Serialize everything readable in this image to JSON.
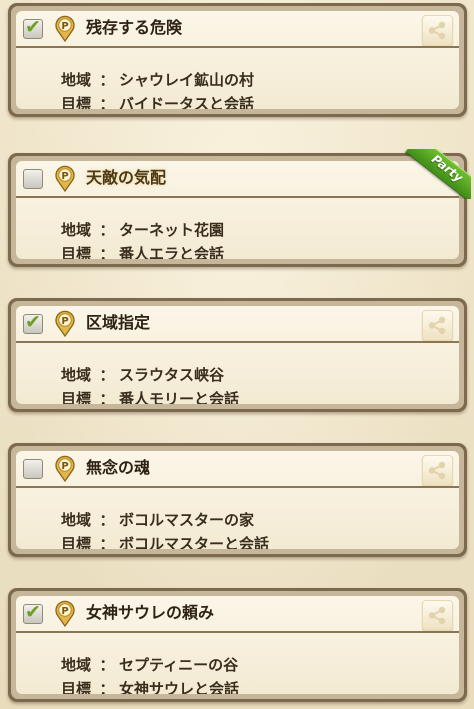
{
  "labels": {
    "region": "地域",
    "objective": "目標",
    "colon": "："
  },
  "quests": [
    {
      "title": "残存する危険",
      "checked": true,
      "region": "シャウレイ鉱山の村",
      "objective": "バイドータスと会話",
      "party": false
    },
    {
      "title": "天敵の気配",
      "checked": false,
      "region": "ターネット花園",
      "objective": "番人エラと会話",
      "party": true,
      "party_label": "Party"
    },
    {
      "title": "区域指定",
      "checked": true,
      "region": "スラウタス峡谷",
      "objective": "番人モリーと会話",
      "party": false
    },
    {
      "title": "無念の魂",
      "checked": false,
      "region": "ボコルマスターの家",
      "objective": "ボコルマスターと会話",
      "party": false
    },
    {
      "title": "女神サウレの頼み",
      "checked": true,
      "region": "セプティニーの谷",
      "objective": "女神サウレと会話",
      "party": false
    }
  ],
  "icons": {
    "checkbox_mark": "✔",
    "quest_type_icon": "p-pin-icon",
    "share_icon": "share-icon"
  },
  "colors": {
    "check_green": "#6da026",
    "party_green": "#4fa21f",
    "p_icon_gold": "#e2b64a",
    "card_border": "#7d6a4e"
  }
}
